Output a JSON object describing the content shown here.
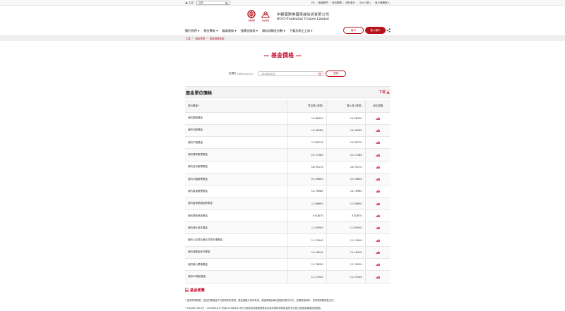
{
  "topbar": {
    "home_label": "主頁",
    "search_placeholder": "搜尋",
    "lang": "EN",
    "links": [
      "聯絡我們",
      "常用問題",
      "資料索引",
      "中小人登入",
      "客戶總體登入"
    ]
  },
  "brand": {
    "boc_caption": "中銀國際",
    "pru_caption": "保誠保險",
    "name_cn": "中銀國際英國保誠信託有限公司",
    "name_en": "BOCI-Prudential Trustee Limited"
  },
  "nav": {
    "items": [
      "關於我們",
      "基金專區",
      "僱員服務",
      "強積金服務",
      "類似強積金計劃",
      "下載及網上工具"
    ],
    "btn_outline": "客戶",
    "btn_solid": "登入帳戶"
  },
  "breadcrumb": [
    "主頁",
    "基金表現",
    "基金價格查詢"
  ],
  "page_title": "— 基金價格 —",
  "date_selector": {
    "label": "定價日",
    "format": "(dd/mm/yyyy)",
    "value": "13/04/2022",
    "query_button": "查詢"
  },
  "table": {
    "title": "基金單位價格",
    "download": "下載",
    "headers": [
      "成分基金*",
      "買出價 (港幣)",
      "贖入價 (港幣)",
      "過往價格"
    ],
    "rows": [
      {
        "name": "我的價長基金",
        "bid": "19.68320",
        "offer": "19.68320"
      },
      {
        "name": "我的均衡基金",
        "bid": "18.38260",
        "offer": "18.38260"
      },
      {
        "name": "我的平穩基金",
        "bid": "15.68710",
        "offer": "15.68710"
      },
      {
        "name": "我的環球股票基金",
        "bid": "23.37380",
        "offer": "23.37380"
      },
      {
        "name": "我的亞洲股票基金",
        "bid": "18.99170",
        "offer": "18.99170"
      },
      {
        "name": "我的中國股票基金",
        "bid": "23.56650",
        "offer": "23.56650"
      },
      {
        "name": "我的香港股票基金",
        "bid": "14.76960",
        "offer": "14.76960"
      },
      {
        "name": "我的香港追蹤指數基金",
        "bid": "12.66650",
        "offer": "12.66650"
      },
      {
        "name": "我的環球債券基金",
        "bid": "9.62870",
        "offer": "9.62870"
      },
      {
        "name": "我的港元保本基金",
        "bid": "11.69500",
        "offer": "11.69500"
      },
      {
        "name": "我的人民幣及港元貨幣市場基金",
        "bid": "11.15940",
        "offer": "11.15940"
      },
      {
        "name": "我的強積金保守基金",
        "bid": "10.16040",
        "offer": "10.16040"
      },
      {
        "name": "我的核心累積基金",
        "bid": "13.78290",
        "offer": "13.78290"
      },
      {
        "name": "我的65歲後基金",
        "bid": "11.37540",
        "offer": "11.37540"
      }
    ]
  },
  "notes": {
    "title": "基金便覽",
    "note1": "* 投資附帶風險，過去的業績並不代表將來的表現。基金價格只供參考用，基金單價及單位價值可跌亦可升，如需詳細資料，請參閱有關銷售文件。",
    "note2": "* 2020年1月10日－2020年6月17日為2020年6月18日代為我的環球股票基金及我的環球債券基金的非交易日各基金價格並無變動。"
  },
  "colors": {
    "brand_red": "#b5121b",
    "title_red": "#c8102e"
  }
}
